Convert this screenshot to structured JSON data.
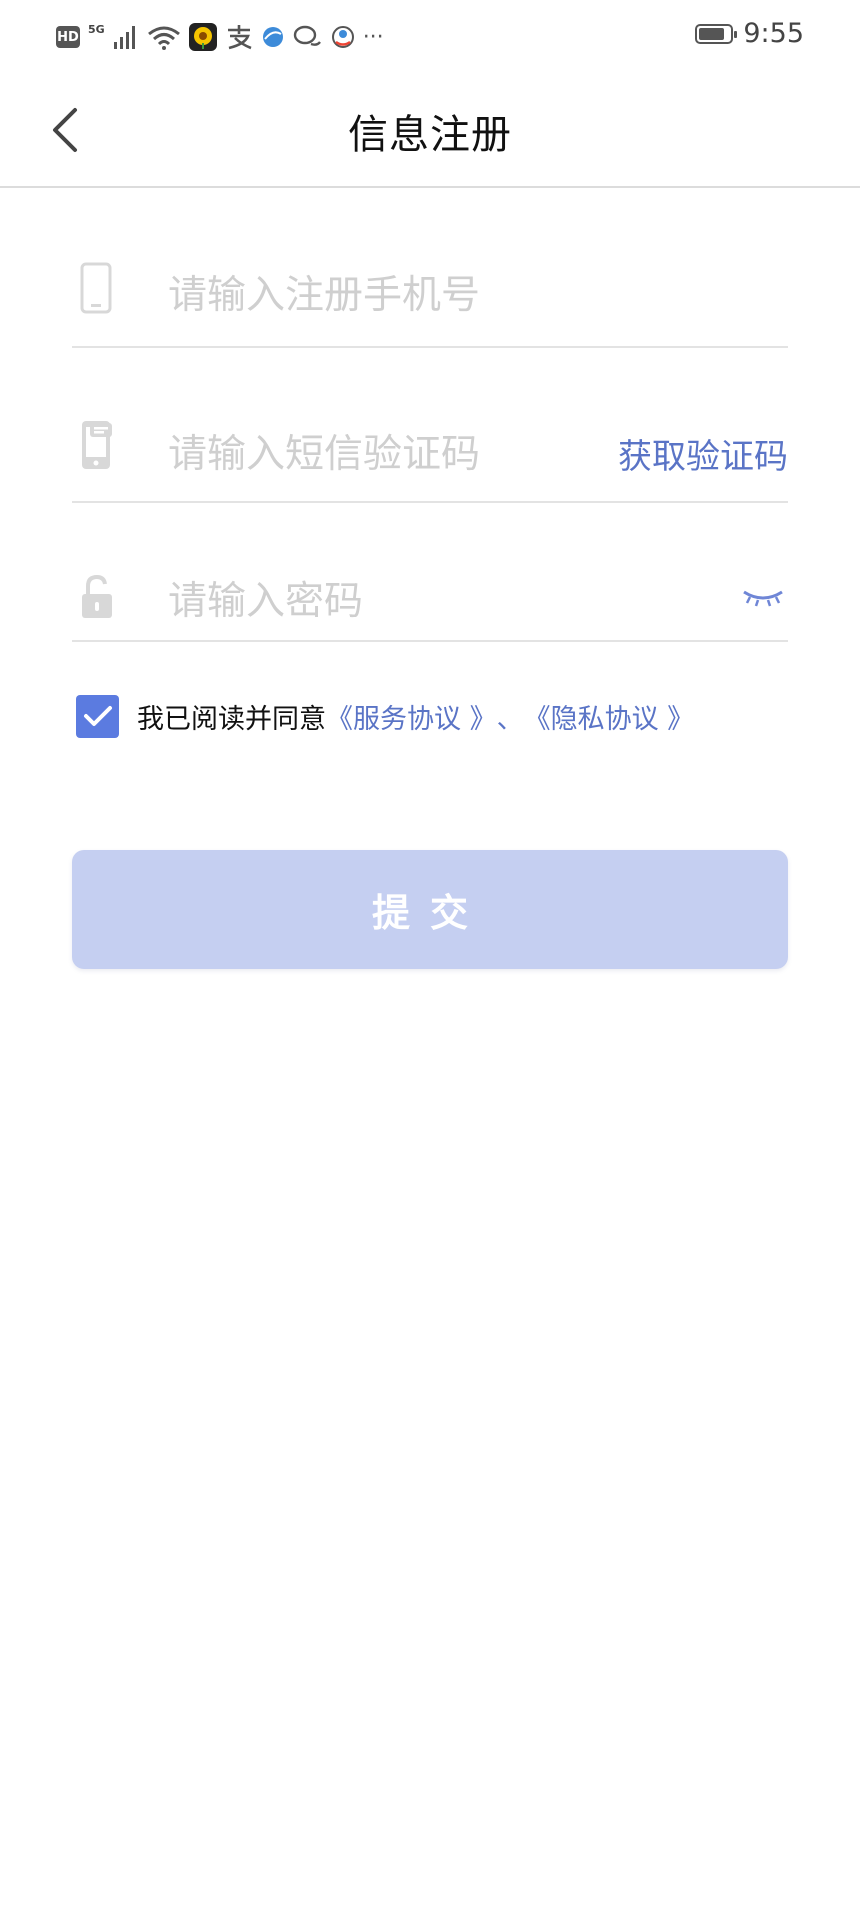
{
  "status_bar": {
    "hd_badge": "HD",
    "network": "5G",
    "time": "9:55",
    "battery_level": 0.85,
    "more_glyph": "···",
    "icons": [
      "signal-icon",
      "wifi-icon",
      "sunflower-app-icon",
      "alipay-icon",
      "browser-icon",
      "chat-icon",
      "location-app-icon"
    ]
  },
  "nav": {
    "title": "信息注册"
  },
  "form": {
    "phone": {
      "placeholder": "请输入注册手机号",
      "value": ""
    },
    "sms_code": {
      "placeholder": "请输入短信验证码",
      "value": "",
      "get_code_label": "获取验证码"
    },
    "password": {
      "placeholder": "请输入密码",
      "value": ""
    }
  },
  "agreement": {
    "checked": true,
    "text": "我已阅读并同意",
    "service_link": "《服务协议 》",
    "separator": "、",
    "privacy_link": "《隐私协议 》"
  },
  "submit": {
    "label": "提交"
  },
  "colors": {
    "accent": "#5b7be0",
    "link": "#5a74c6",
    "submit_disabled": "#c5cff1",
    "placeholder": "#cfcfcf"
  }
}
